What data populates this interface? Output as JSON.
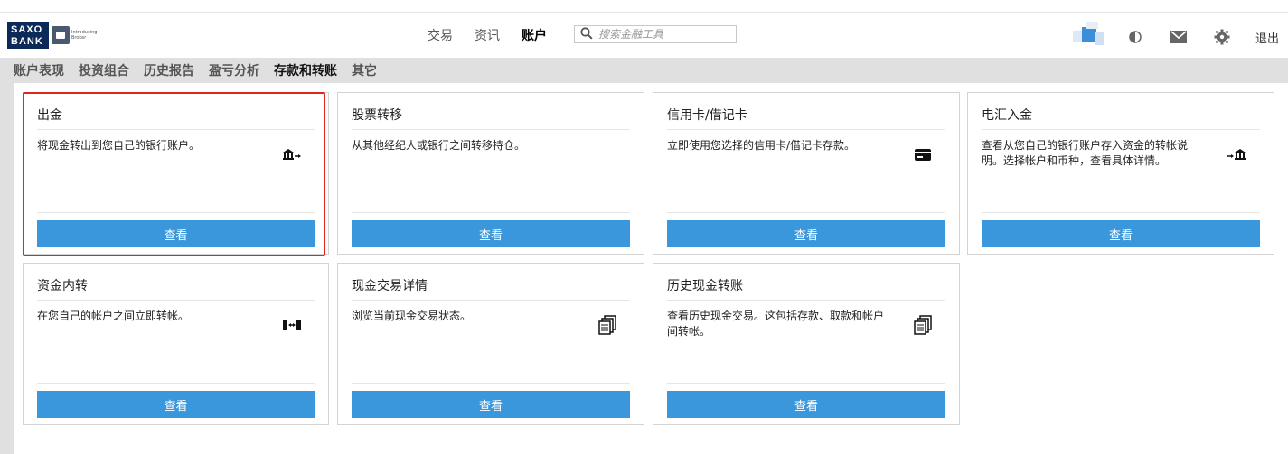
{
  "header": {
    "logo_line1": "SAXO",
    "logo_line2": "BANK",
    "logo_sub": "Introducing Broker",
    "nav": [
      {
        "label": "交易",
        "active": false
      },
      {
        "label": "资讯",
        "active": false
      },
      {
        "label": "账户",
        "active": true
      }
    ],
    "search_placeholder": "搜索金融工具",
    "logout": "退出"
  },
  "subnav": [
    {
      "label": "账户表现",
      "active": false
    },
    {
      "label": "投资组合",
      "active": false
    },
    {
      "label": "历史报告",
      "active": false
    },
    {
      "label": "盈亏分析",
      "active": false
    },
    {
      "label": "存款和转账",
      "active": true
    },
    {
      "label": "其它",
      "active": false
    }
  ],
  "cards": [
    {
      "title": "出金",
      "desc": "将现金转出到您自己的银行账户。",
      "icon": "bank-out-icon",
      "button": "查看"
    },
    {
      "title": "股票转移",
      "desc": "从其他经纪人或银行之间转移持仓。",
      "icon": "",
      "button": "查看"
    },
    {
      "title": "信用卡/借记卡",
      "desc": "立即使用您选择的信用卡/借记卡存款。",
      "icon": "credit-card-icon",
      "button": "查看"
    },
    {
      "title": "电汇入金",
      "desc": "查看从您自己的银行账户存入资金的转帐说明。选择帐户和币种，查看具体详情。",
      "icon": "bank-in-icon",
      "button": "查看"
    },
    {
      "title": "资金内转",
      "desc": "在您自己的帐户之间立即转帐。",
      "icon": "internal-transfer-icon",
      "button": "查看"
    },
    {
      "title": "现金交易详情",
      "desc": "浏览当前现金交易状态。",
      "icon": "documents-icon",
      "button": "查看"
    },
    {
      "title": "历史现金转账",
      "desc": "查看历史现金交易。这包括存款、取款和帐户间转帐。",
      "icon": "documents-icon",
      "button": "查看"
    }
  ],
  "colors": {
    "accent": "#3a97dc",
    "highlight": "#e3261d",
    "brand": "#0b2a57"
  }
}
